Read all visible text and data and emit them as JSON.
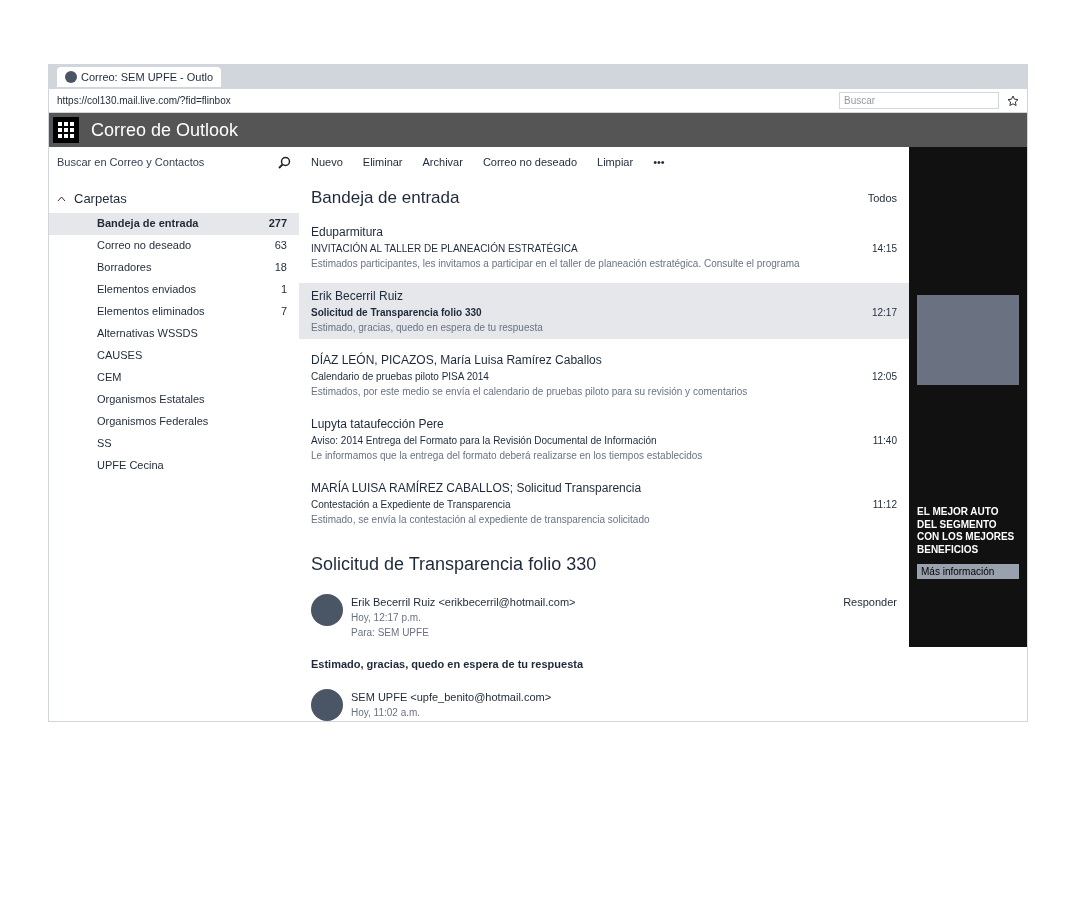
{
  "browser": {
    "tab_title": "Correo: SEM UPFE - Outlo",
    "address": "https://col130.mail.live.com/?fid=flinbox",
    "search_placeholder": "Buscar"
  },
  "header": {
    "app_title": "Correo de Outlook"
  },
  "search": {
    "placeholder": "Buscar en Correo y Contactos"
  },
  "toolbar": [
    "Nuevo",
    "Eliminar",
    "Archivar",
    "Correo no deseado",
    "Limpiar",
    "•••"
  ],
  "folders_heading": "Carpetas",
  "folders": [
    {
      "name": "Bandeja de entrada",
      "count": "277",
      "selected": true
    },
    {
      "name": "Correo no deseado",
      "count": "63",
      "selected": false
    },
    {
      "name": "Borradores",
      "count": "18",
      "selected": false
    },
    {
      "name": "Elementos enviados",
      "count": "1",
      "selected": false
    },
    {
      "name": "Elementos eliminados",
      "count": "7",
      "selected": false
    },
    {
      "name": "Alternativas WSSDS",
      "selected": false
    },
    {
      "name": "CAUSES",
      "selected": false
    },
    {
      "name": "CEM",
      "selected": false
    },
    {
      "name": "Organismos Estatales",
      "selected": false
    },
    {
      "name": "Organismos Federales",
      "selected": false
    },
    {
      "name": "SS",
      "selected": false
    },
    {
      "name": "UPFE Cecina",
      "selected": false
    }
  ],
  "inbox": {
    "title": "Bandeja de entrada",
    "filter": "Todos"
  },
  "messages": [
    {
      "sender": "Eduparmitura",
      "subject": "INVITACIÓN AL TALLER DE PLANEACIÓN ESTRATÉGICA",
      "date": "14:15",
      "preview": "Estimados participantes, les invitamos a participar en el taller de planeación estratégica. Consulte el programa",
      "selected": false
    },
    {
      "sender": "Erik Becerril Ruiz",
      "subject": "Solicitud de Transparencia folio 330",
      "date": "12:17",
      "preview": "Estimado, gracias, quedo en espera de tu respuesta",
      "selected": true
    },
    {
      "sender": "DÍAZ LEÓN, PICAZOS, María Luisa Ramírez Caballos",
      "subject": "Calendario de pruebas piloto PISA 2014",
      "date": "12:05",
      "preview": "Estimados, por este medio se envía el calendario de pruebas piloto para su revisión y comentarios",
      "selected": false
    },
    {
      "sender": "Lupyta tataufección Pere",
      "subject": "Aviso: 2014 Entrega del Formato para la Revisión Documental de Información",
      "date": "11:40",
      "preview": "Le informamos que la entrega del formato deberá realizarse en los tiempos establecidos",
      "selected": false
    },
    {
      "sender": "MARÍA LUISA RAMÍREZ CABALLOS; Solicitud Transparencia",
      "subject": "Contestación a Expediente de Transparencia",
      "date": "11:12",
      "preview": "Estimado, se envía la contestación al expediente de transparencia solicitado",
      "selected": false
    }
  ],
  "reading": {
    "subject": "Solicitud de Transparencia folio 330",
    "messages": [
      {
        "from": "Erik Becerril Ruiz <erikbecerril@hotmail.com>",
        "time": "Hoy, 12:17 p.m.",
        "to": "Para: SEM UPFE",
        "reply": "Responder",
        "body": "Estimado, gracias, quedo en espera de tu respuesta"
      },
      {
        "from": "SEM UPFE <upfe_benito@hotmail.com>",
        "time": "Hoy, 11:02 a.m."
      }
    ]
  },
  "ad": {
    "headline": "EL MEJOR AUTO DEL SEGMENTO CON LOS MEJORES BENEFICIOS",
    "button": "Más información"
  }
}
